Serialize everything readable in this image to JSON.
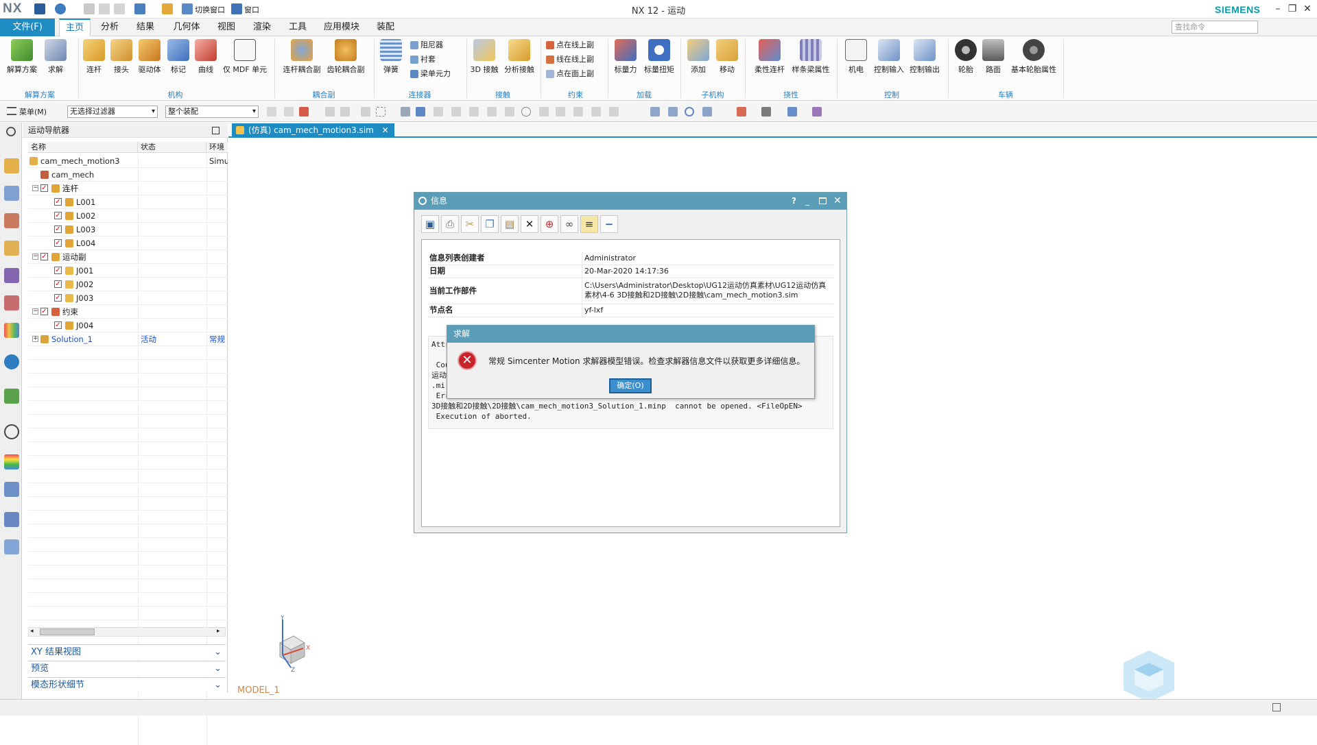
{
  "app": {
    "logo": "NX",
    "title": "NX 12 - 运动",
    "brand": "SIEMENS",
    "quick_access": {
      "switch_window": "切换窗口",
      "window": "窗口"
    },
    "window_controls": {
      "minimize": "–",
      "restore": "❐",
      "close": "✕"
    }
  },
  "menubar": {
    "file": "文件(F)",
    "tabs": [
      "主页",
      "分析",
      "结果",
      "几何体",
      "视图",
      "渲染",
      "工具",
      "应用模块",
      "装配"
    ],
    "active_tab": "主页",
    "search_placeholder": "查找命令"
  },
  "ribbon": {
    "groups": [
      {
        "name": "解算方案",
        "buttons": [
          "解算方案",
          "求解"
        ]
      },
      {
        "name": "机构",
        "buttons": [
          "连杆",
          "接头",
          "驱动体",
          "标记",
          "曲线",
          "仅 MDF 单元"
        ]
      },
      {
        "name": "耦合副",
        "buttons": [
          "连杆耦合副",
          "齿轮耦合副"
        ]
      },
      {
        "name": "连接器",
        "buttons": [
          "弹簧"
        ],
        "small": [
          "阻尼器",
          "衬套",
          "梁单元力"
        ]
      },
      {
        "name": "接触",
        "buttons": [
          "3D 接触",
          "分析接触"
        ]
      },
      {
        "name": "约束",
        "small": [
          "点在线上副",
          "线在线上副",
          "点在面上副"
        ]
      },
      {
        "name": "加载",
        "buttons": [
          "标量力",
          "标量扭矩"
        ]
      },
      {
        "name": "子机构",
        "buttons": [
          "添加",
          "移动"
        ]
      },
      {
        "name": "挠性",
        "buttons": [
          "柔性连杆",
          "样条梁属性"
        ]
      },
      {
        "name": "控制",
        "buttons": [
          "机电",
          "控制输入",
          "控制输出"
        ]
      },
      {
        "name": "车辆",
        "buttons": [
          "轮胎",
          "路面",
          "基本轮胎属性"
        ]
      }
    ]
  },
  "toolbar2": {
    "menu": "菜单(M)",
    "filter": "无选择过滤器",
    "scope": "整个装配"
  },
  "navigator": {
    "title": "运动导航器",
    "columns": [
      "名称",
      "状态",
      "环境"
    ],
    "rows": [
      {
        "name": "cam_mech_motion3",
        "state": "",
        "env": "Simu",
        "level": 0,
        "icon": "sim-icon"
      },
      {
        "name": "cam_mech",
        "state": "",
        "env": "",
        "level": 1,
        "icon": "assembly-icon"
      },
      {
        "name": "连杆",
        "state": "",
        "env": "",
        "level": 1,
        "icon": "link-folder-icon",
        "checked": true,
        "expander": "−"
      },
      {
        "name": "L001",
        "state": "",
        "env": "",
        "level": 2,
        "icon": "link-icon",
        "checked": true
      },
      {
        "name": "L002",
        "state": "",
        "env": "",
        "level": 2,
        "icon": "link-icon",
        "checked": true
      },
      {
        "name": "L003",
        "state": "",
        "env": "",
        "level": 2,
        "icon": "link-icon",
        "checked": true
      },
      {
        "name": "L004",
        "state": "",
        "env": "",
        "level": 2,
        "icon": "link-icon",
        "checked": true
      },
      {
        "name": "运动副",
        "state": "",
        "env": "",
        "level": 1,
        "icon": "joint-folder-icon",
        "checked": true,
        "expander": "−"
      },
      {
        "name": "J001",
        "state": "",
        "env": "",
        "level": 2,
        "icon": "joint-icon",
        "checked": true
      },
      {
        "name": "J002",
        "state": "",
        "env": "",
        "level": 2,
        "icon": "joint-icon",
        "checked": true
      },
      {
        "name": "J003",
        "state": "",
        "env": "",
        "level": 2,
        "icon": "joint-icon",
        "checked": true
      },
      {
        "name": "约束",
        "state": "",
        "env": "",
        "level": 1,
        "icon": "constraint-folder-icon",
        "checked": true,
        "expander": "−"
      },
      {
        "name": "J004",
        "state": "",
        "env": "",
        "level": 2,
        "icon": "constraint-icon",
        "checked": true
      },
      {
        "name": "Solution_1",
        "state": "活动",
        "env": "常规",
        "level": 1,
        "icon": "solution-icon",
        "highlight": true,
        "expander": "+"
      }
    ],
    "panels": [
      "XY 结果视图",
      "预览",
      "模态形状细节"
    ]
  },
  "document": {
    "tab": "(仿真) cam_mech_motion3.sim",
    "model_label": "MODEL_1"
  },
  "info_window": {
    "title": "信息",
    "toolbar_icons": [
      "save-icon",
      "print-icon",
      "cut-icon",
      "copy-icon",
      "paste-icon",
      "delete-icon",
      "find-icon",
      "binoculars-icon",
      "wrap-icon",
      "collapse-icon"
    ],
    "fields": [
      {
        "key": "信息列表创建者",
        "value": "Administrator"
      },
      {
        "key": "日期",
        "value": "20-Mar-2020 14:17:36"
      },
      {
        "key": "当前工作部件",
        "value": "C:\\Users\\Administrator\\Desktop\\UG12运动仿真素材\\UG12运动仿真素材\\4-6 3D接触和2D接触\\2D接触\\cam_mech_motion3.sim"
      },
      {
        "key": "节点名",
        "value": "yf-lxf"
      }
    ],
    "log_text": "Attr\n\n Cou                                                                     G12\n运动\n.mi\n Err                                                                     6\n3D接触和2D接触\\2D接触\\cam_mech_motion3_Solution_1.minp  cannot be opened. <FileOpEN>\n Execution of aborted."
  },
  "error_dialog": {
    "title": "求解",
    "message": "常规 Simcenter Motion 求解器模型错误。检查求解器信息文件以获取更多详细信息。",
    "ok": "确定(O)"
  },
  "colors": {
    "accent": "#1e8cc3",
    "dialog_title": "#5b9cb6",
    "error_red": "#c8242b",
    "brand": "#0a9bab"
  }
}
